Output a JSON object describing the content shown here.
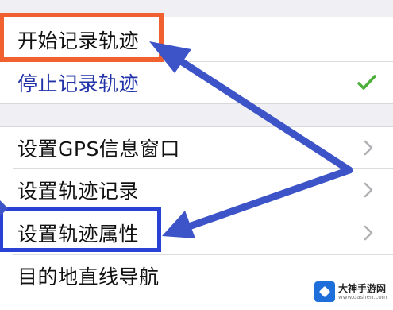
{
  "menu": {
    "group1": [
      {
        "label": "开始记录轨迹",
        "accessory": "none"
      },
      {
        "label": "停止记录轨迹",
        "accessory": "checkmark"
      }
    ],
    "group2": [
      {
        "label": "设置GPS信息窗口",
        "accessory": "chevron-right-icon"
      },
      {
        "label": "设置轨迹记录",
        "accessory": "chevron-right-icon"
      },
      {
        "label": "设置轨迹属性",
        "accessory": "chevron-right-icon"
      },
      {
        "label": "目的地直线导航",
        "accessory": "none"
      }
    ]
  },
  "annotations": {
    "orange_box_color": "#f0612f",
    "blue_box_color": "#2a41d6",
    "arrow_color": "#3d54c8"
  },
  "watermark": {
    "main": "大神手游网",
    "sub": "www.dashen.com"
  },
  "colors": {
    "active_text": "#2233a8",
    "checkmark": "#4caf3a",
    "chevron": "#b0b0b5",
    "background": "#efeff4"
  }
}
